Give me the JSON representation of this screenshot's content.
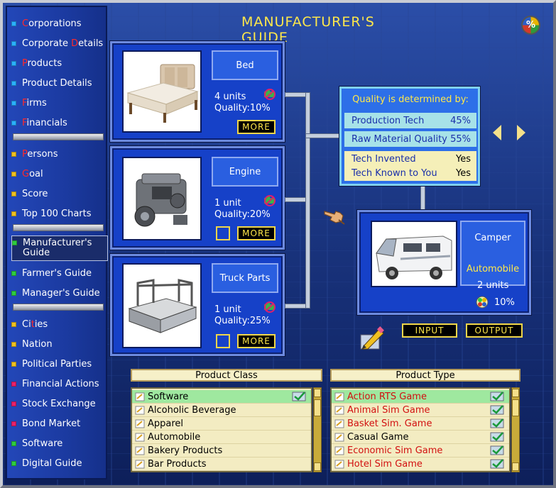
{
  "title": "MANUFACTURER'S GUIDE",
  "sidebar": {
    "items": [
      {
        "label_hl": "C",
        "label_rest": "orporations",
        "color": "#2ab0ff"
      },
      {
        "label": "Corporate Details",
        "color": "#2ab0ff",
        "hl_html": "Corporate <span class='hl'>D</span>etails"
      },
      {
        "label_hl": "P",
        "label_rest": "roducts",
        "color": "#2ab0ff"
      },
      {
        "label": "Product Details",
        "color": "#2ab0ff"
      },
      {
        "label_hl": "F",
        "label_rest": "irms",
        "color": "#2ab0ff"
      },
      {
        "label_hl": "F",
        "label_rest": "inancials",
        "color": "#2ab0ff"
      },
      {
        "label_hl": "P",
        "label_rest": "ersons",
        "color": "#f0c020"
      },
      {
        "label_hl": "G",
        "label_rest": "oal",
        "color": "#f0c020"
      },
      {
        "label": "Score",
        "color": "#f0c020"
      },
      {
        "label": "Top 100 Charts",
        "color": "#f0c020"
      },
      {
        "label": "Manufacturer's Guide",
        "color": "#2ecc40"
      },
      {
        "label": "Farmer's Guide",
        "color": "#2ecc40"
      },
      {
        "label": "Manager's Guide",
        "color": "#2ecc40"
      },
      {
        "label_pre": "Ci",
        "label_hl": "t",
        "label_rest": "ies",
        "color": "#f0c020"
      },
      {
        "label": "Nation",
        "color": "#f0c020"
      },
      {
        "label": "Political Parties",
        "color": "#f0c020"
      },
      {
        "label": "Financial Actions",
        "color": "#e8206a"
      },
      {
        "label": "Stock Exchange",
        "color": "#e8206a"
      },
      {
        "label": "Bond Market",
        "color": "#e8206a"
      },
      {
        "label": "Software",
        "color": "#2ecc40"
      },
      {
        "label": "Digital Guide",
        "color": "#2ecc40"
      }
    ]
  },
  "inputs": [
    {
      "name": "Bed",
      "units": "4 units",
      "quality_label": "Quality:",
      "quality": "10%",
      "more": "MORE"
    },
    {
      "name": "Engine",
      "units": "1 unit",
      "quality_label": "Quality:",
      "quality": "20%",
      "more": "MORE"
    },
    {
      "name": "Truck Parts",
      "units": "1 unit",
      "quality_label": "Quality:",
      "quality": "25%",
      "more": "MORE"
    }
  ],
  "quality_panel": {
    "title": "Quality is determined by:",
    "rows": [
      {
        "label": "Production Tech",
        "value": "45%"
      },
      {
        "label": "Raw Material Quality",
        "value": "55%"
      },
      {
        "label": "Tech Invented",
        "value": "Yes"
      },
      {
        "label": "Tech Known to You",
        "value": "Yes"
      }
    ]
  },
  "output": {
    "name": "Camper",
    "class": "Automobile",
    "units": "2 units",
    "quality": "10%"
  },
  "buttons": {
    "input": "INPUT",
    "output": "OUTPUT"
  },
  "product_class": {
    "header": "Product Class",
    "rows": [
      "Software",
      "Alcoholic Beverage",
      "Apparel",
      "Automobile",
      "Bakery Products",
      "Bar Products"
    ]
  },
  "product_type": {
    "header": "Product Type",
    "rows": [
      "Action RTS Game",
      "Animal Sim Game",
      "Basket Sim. Game",
      "Casual Game",
      "Economic Sim Game",
      "Hotel Sim Game"
    ]
  }
}
